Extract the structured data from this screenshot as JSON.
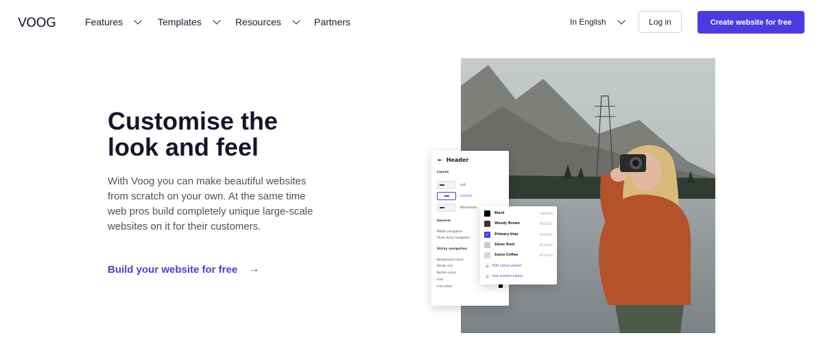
{
  "nav": {
    "logo": "VOOG",
    "items": [
      {
        "label": "Features",
        "dropdown": true
      },
      {
        "label": "Templates",
        "dropdown": true
      },
      {
        "label": "Resources",
        "dropdown": true
      },
      {
        "label": "Partners",
        "dropdown": false
      }
    ],
    "language": "In English",
    "login": "Log in",
    "cta": "Create website for free"
  },
  "hero": {
    "title": "Customise the look and feel",
    "body": "With Voog you can make beautiful websites from scratch on your own. At the same time web pros build completely unique large-scale websites on it for their customers.",
    "link": "Build your website for free",
    "link_icon": "arrow-right-icon"
  },
  "panel": {
    "back_icon": "arrow-left-icon",
    "title": "Header",
    "layout_label": "Layout",
    "layout_options": [
      "Left",
      "Content",
      "Minimalistic"
    ],
    "general_label": "General",
    "general_items": [
      "Mobile navigation",
      "Show sticky navigation"
    ],
    "sticky_label": "Sticky navigation",
    "sticky_items": [
      "Background colour",
      "Border size",
      "Border colour",
      "Font",
      "Link colour"
    ]
  },
  "colors": {
    "items": [
      {
        "name": "Black",
        "hex": "#000000",
        "swatch": "#000000"
      },
      {
        "name": "Woody Brown",
        "hex": "#4A2C2C",
        "swatch": "#4a2c2c"
      },
      {
        "name": "Primary blue",
        "hex": "#4A2C2C",
        "swatch": "#4a3ce3"
      },
      {
        "name": "Silver Rust",
        "hex": "#CFCACA",
        "swatch": "#cfcaca"
      },
      {
        "name": "Swiss Coffee",
        "hex": "#CFCACA",
        "swatch": "#dcd6d6"
      }
    ],
    "edit_label": "Edit colour preset",
    "custom_label": "Use custom colour"
  },
  "theme": {
    "accent": "#4a3ce3",
    "text": "#15152a"
  }
}
